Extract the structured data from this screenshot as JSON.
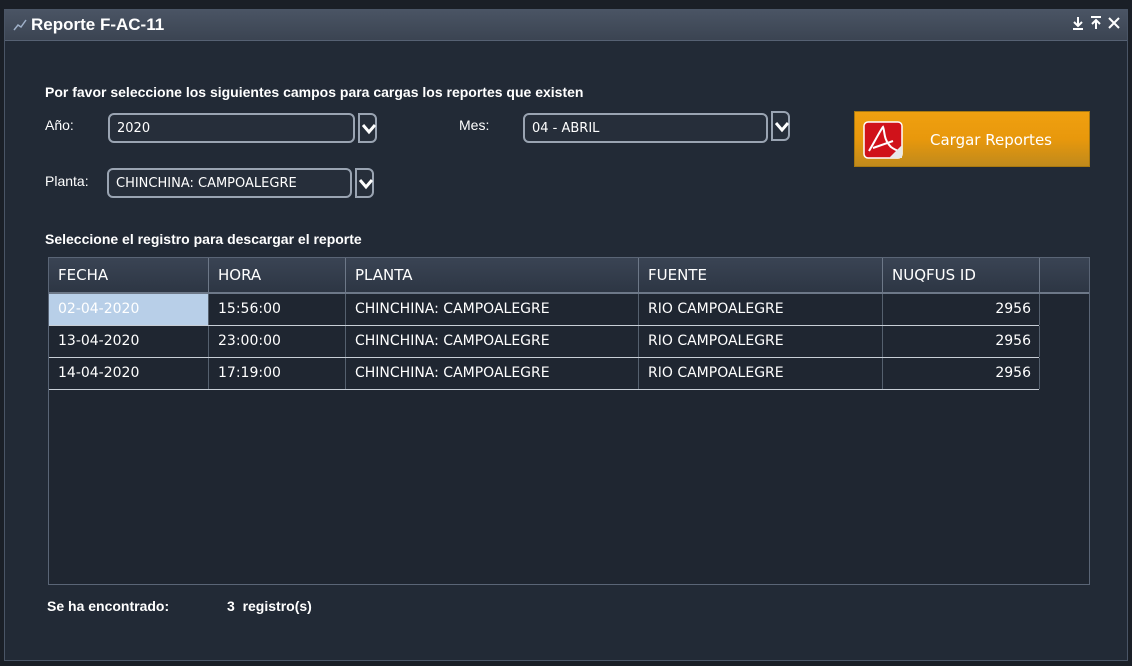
{
  "window": {
    "title": "Reporte F-AC-11",
    "controls": [
      "download-icon",
      "pin-icon",
      "close-icon"
    ]
  },
  "form": {
    "instruction": "Por favor seleccione los siguientes campos para cargas los reportes que existen",
    "year_label": "Año:",
    "year_value": "2020",
    "month_label": "Mes:",
    "month_value": "04 - ABRIL",
    "plant_label": "Planta:",
    "plant_value": "CHINCHINA: CAMPOALEGRE",
    "load_button": "Cargar Reportes"
  },
  "table": {
    "caption": "Seleccione el registro para descargar el reporte",
    "columns": [
      "FECHA",
      "HORA",
      "PLANTA",
      "FUENTE",
      "NUQFUS ID"
    ],
    "rows": [
      {
        "fecha": "02-04-2020",
        "hora": "15:56:00",
        "planta": "CHINCHINA: CAMPOALEGRE",
        "fuente": "RIO CAMPOALEGRE",
        "id": "2956"
      },
      {
        "fecha": "13-04-2020",
        "hora": "23:00:00",
        "planta": "CHINCHINA: CAMPOALEGRE",
        "fuente": "RIO CAMPOALEGRE",
        "id": "2956"
      },
      {
        "fecha": "14-04-2020",
        "hora": "17:19:00",
        "planta": "CHINCHINA: CAMPOALEGRE",
        "fuente": "RIO CAMPOALEGRE",
        "id": "2956"
      }
    ],
    "selected_row": 0
  },
  "footer": {
    "found_label": "Se ha encontrado:",
    "count_text": "3  registro(s)"
  },
  "colors": {
    "background": "#222a36",
    "accent_button": "#e8980c",
    "selected_cell": "#b8cfe8"
  }
}
